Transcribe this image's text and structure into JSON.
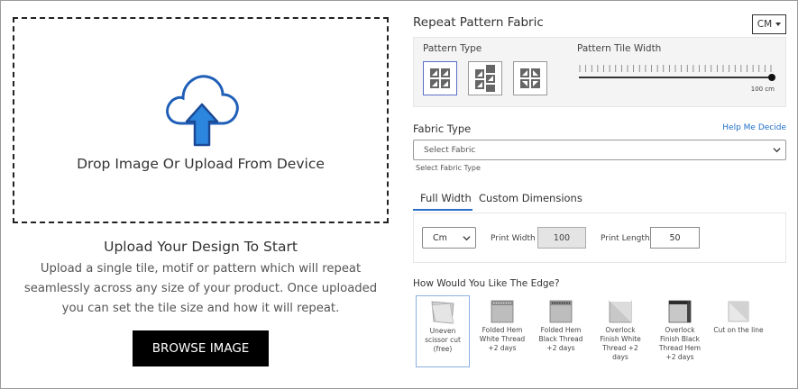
{
  "upload": {
    "drop_text": "Drop Image Or Upload From Device",
    "title": "Upload Your Design To Start",
    "description": "Upload a single tile, motif or pattern which will repeat seamlessly across any size of your product. Once uploaded you can set the tile size and how it will repeat.",
    "browse_label": "BROWSE IMAGE"
  },
  "panel": {
    "title": "Repeat Pattern Fabric",
    "unit": "CM"
  },
  "pattern": {
    "type_label": "Pattern Type",
    "tile_width_label": "Pattern Tile Width",
    "tile_width_value": "100 cm",
    "selected_index": 0,
    "options": [
      "grid-repeat-icon",
      "half-drop-repeat-icon",
      "mirror-repeat-icon"
    ]
  },
  "fabric": {
    "label": "Fabric Type",
    "help_link": "Help Me Decide",
    "placeholder": "Select Fabric",
    "hint": "Select Fabric Type"
  },
  "tabs": [
    {
      "label": "Full Width",
      "active": true
    },
    {
      "label": "Custom Dimensions",
      "active": false
    }
  ],
  "dimensions": {
    "unit": "Cm",
    "print_width_label": "Print Width",
    "print_width_value": "100",
    "print_length_label": "Print Length",
    "print_length_value": "50"
  },
  "edge": {
    "label": "How Would You Like The Edge?",
    "options": [
      {
        "label": "Uneven scissor cut (free)",
        "icon": "scissor-cut-edge-icon",
        "selected": true
      },
      {
        "label": "Folded Hem White Thread +2 days",
        "icon": "folded-hem-white-icon",
        "selected": false
      },
      {
        "label": "Folded Hem Black Thread +2 days",
        "icon": "folded-hem-black-icon",
        "selected": false
      },
      {
        "label": "Overlock Finish White Thread +2 days",
        "icon": "overlock-white-icon",
        "selected": false
      },
      {
        "label": "Overlock Finish Black Thread Hem +2 days",
        "icon": "overlock-black-icon",
        "selected": false
      },
      {
        "label": "Cut on the line",
        "icon": "cut-line-edge-icon",
        "selected": false
      }
    ]
  },
  "colors": {
    "accent": "#2b6ec8",
    "button_bg": "#000000",
    "cloud_stroke": "#1f5fb8"
  }
}
